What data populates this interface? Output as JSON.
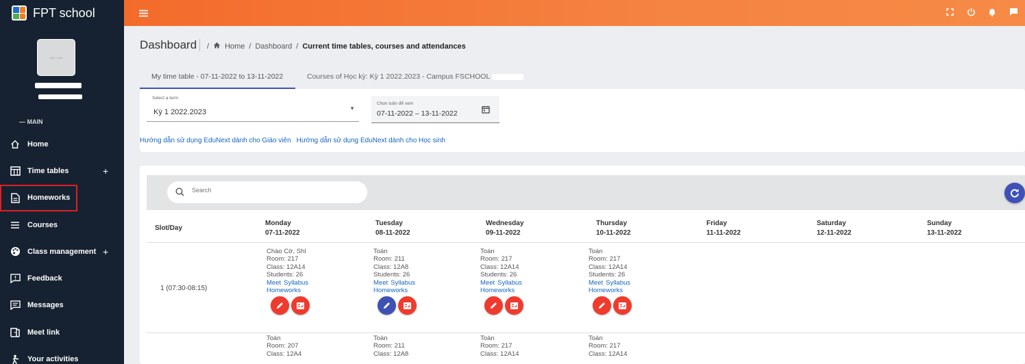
{
  "brand": {
    "name": "FPT school"
  },
  "sidebar": {
    "avatar_text": "100 × 100",
    "section": "— MAIN",
    "items": [
      {
        "label": "Home",
        "icon": "home-icon"
      },
      {
        "label": "Time tables",
        "icon": "table-icon",
        "expandable": true
      },
      {
        "label": "Homeworks",
        "icon": "document-icon"
      },
      {
        "label": "Courses",
        "icon": "list-icon"
      },
      {
        "label": "Class management",
        "icon": "palette-icon",
        "expandable": true
      },
      {
        "label": "Feedback",
        "icon": "feedback-icon"
      },
      {
        "label": "Messages",
        "icon": "message-icon"
      },
      {
        "label": "Meet link",
        "icon": "meet-icon"
      },
      {
        "label": "Your activities",
        "icon": "activity-icon"
      }
    ],
    "plus": "+"
  },
  "header": {
    "icons": [
      "fullscreen-icon",
      "power-icon",
      "bell-icon",
      "chat-icon"
    ]
  },
  "page": {
    "title": "Dashboard",
    "breadcrumb": {
      "sep": "/",
      "home": "Home",
      "dashboard": "Dashboard",
      "current": "Current time tables, courses and attendances"
    }
  },
  "tabs": [
    {
      "label": "My time table - 07-11-2022 to 13-11-2022",
      "active": true
    },
    {
      "label": "Courses of Học kỳ: Kỳ 1 2022.2023 - Campus FSCHOOL",
      "active": false
    }
  ],
  "filters": {
    "term_label": "Select a term",
    "term_value": "Kỳ 1 2022.2023",
    "week_label": "Chọn tuần để xem",
    "week_value": "07-11-2022 – 13-11-2022",
    "guide_teacher": "Hướng dẫn sử dụng EduNext dành cho Giáo viên",
    "guide_student": "Hướng dẫn sử dụng EduNext dành cho Học sinh"
  },
  "search": {
    "placeholder": "Search"
  },
  "table": {
    "slot_header": "Slot/Day",
    "days": [
      {
        "name": "Monday",
        "date": "07-11-2022"
      },
      {
        "name": "Tuesday",
        "date": "08-11-2022"
      },
      {
        "name": "Wednesday",
        "date": "09-11-2022"
      },
      {
        "name": "Thursday",
        "date": "10-11-2022"
      },
      {
        "name": "Friday",
        "date": "11-11-2022"
      },
      {
        "name": "Saturday",
        "date": "12-11-2022"
      },
      {
        "name": "Sunday",
        "date": "13-11-2022"
      }
    ],
    "rows": [
      {
        "slot": "1 (07:30-08:15)",
        "cells": [
          {
            "subject": "Chào Cờ, Shl",
            "room": "Room: 217",
            "class": "Class: 12A14",
            "students": "Students: 26",
            "meet": "Meet",
            "syllabus": "Syllabus",
            "homeworks": "Homeworks",
            "edit_color": "#ef3b2d"
          },
          {
            "subject": "Toán",
            "room": "Room: 211",
            "class": "Class: 12A8",
            "students": "Students: 26",
            "meet": "Meet",
            "syllabus": "Syllabus",
            "homeworks": "Homeworks",
            "edit_color": "#3f51b5"
          },
          {
            "subject": "Toán",
            "room": "Room: 217",
            "class": "Class: 12A14",
            "students": "Students: 26",
            "meet": "Meet",
            "syllabus": "Syllabus",
            "homeworks": "Homeworks",
            "edit_color": "#ef3b2d"
          },
          {
            "subject": "Toán",
            "room": "Room: 217",
            "class": "Class: 12A14",
            "students": "Students: 26",
            "meet": "Meet",
            "syllabus": "Syllabus",
            "homeworks": "Homeworks",
            "edit_color": "#ef3b2d"
          }
        ]
      },
      {
        "slot": "",
        "cells": [
          {
            "subject": "Toán",
            "room": "Room: 207",
            "class": "Class: 12A4"
          },
          {
            "subject": "Toán",
            "room": "Room: 211",
            "class": "Class: 12A8"
          },
          {
            "subject": "Toán",
            "room": "Room: 217",
            "class": "Class: 12A14"
          },
          {
            "subject": "Toán",
            "room": "Room: 217",
            "class": "Class: 12A14"
          }
        ]
      }
    ]
  },
  "colors": {
    "header": "#f36b2b",
    "sidebar": "#162231",
    "accent": "#3f51b5",
    "danger": "#ef3b2d",
    "link": "#1565c0"
  }
}
